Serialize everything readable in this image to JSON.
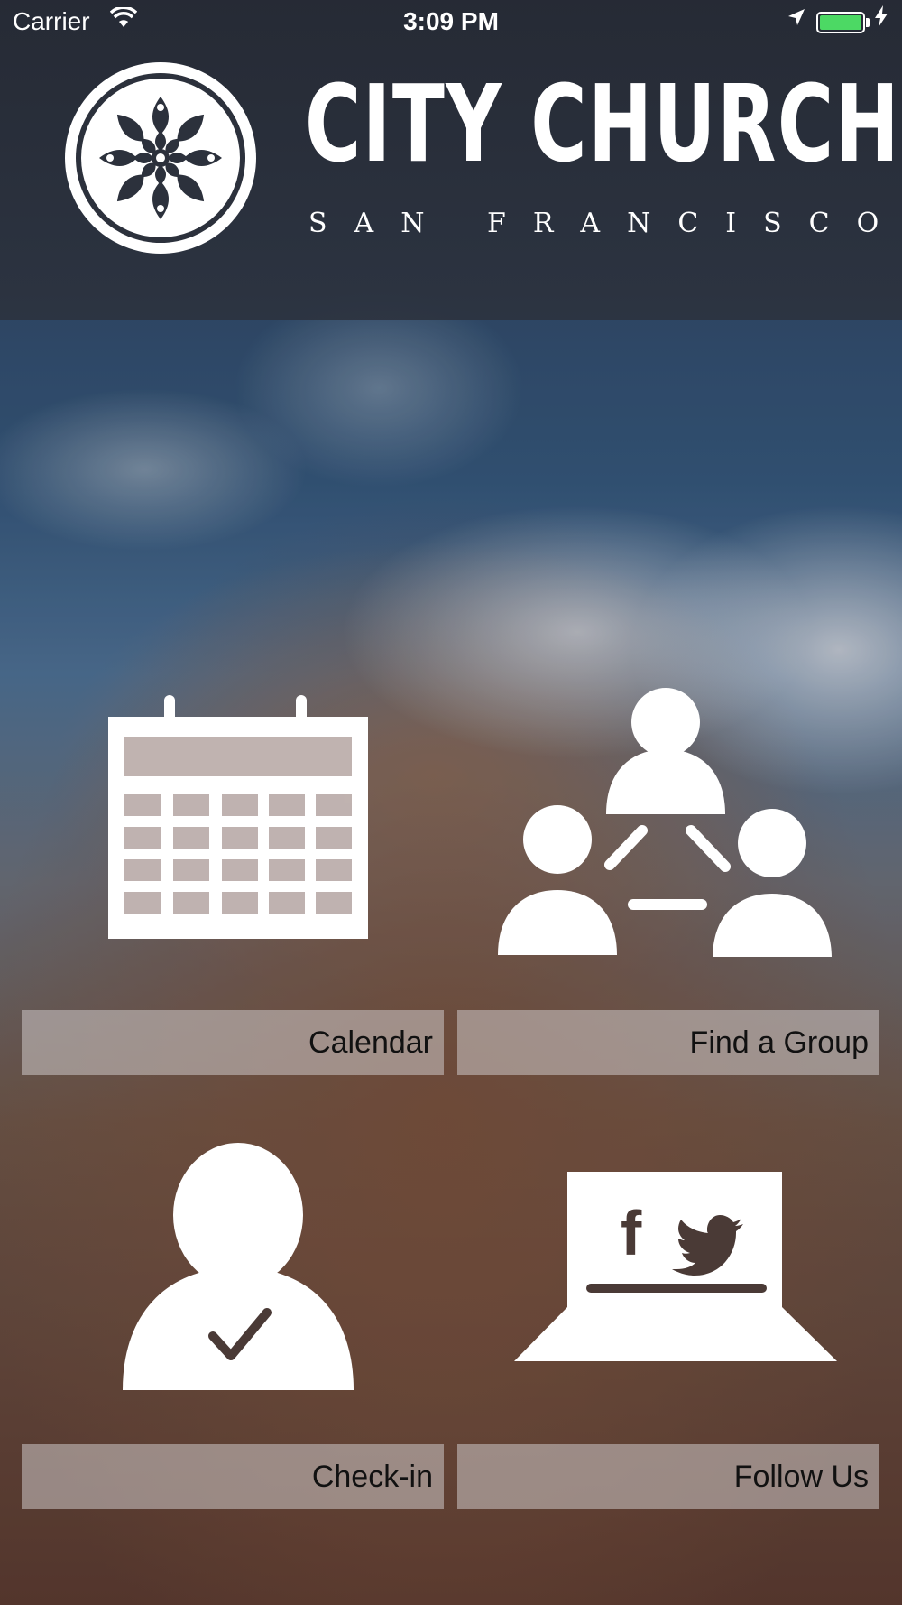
{
  "status_bar": {
    "carrier": "Carrier",
    "time": "3:09 PM",
    "wifi_icon": "wifi-icon",
    "location_icon": "location-arrow-icon",
    "battery_icon": "battery-icon",
    "charging_icon": "bolt-icon",
    "battery_color": "#4cd964"
  },
  "header": {
    "logo_icon": "church-emblem-icon",
    "title": "CITY CHURCH",
    "subtitle": "SAN FRANCISCO"
  },
  "tiles": [
    {
      "label": "Calendar",
      "icon": "calendar-icon"
    },
    {
      "label": "Find a Group",
      "icon": "group-network-icon"
    },
    {
      "label": "Check-in",
      "icon": "person-check-icon"
    },
    {
      "label": "Follow Us",
      "icon": "laptop-social-icon"
    }
  ],
  "social": {
    "facebook": "f"
  },
  "colors": {
    "icon": "#ffffff",
    "label_text": "#111111"
  }
}
